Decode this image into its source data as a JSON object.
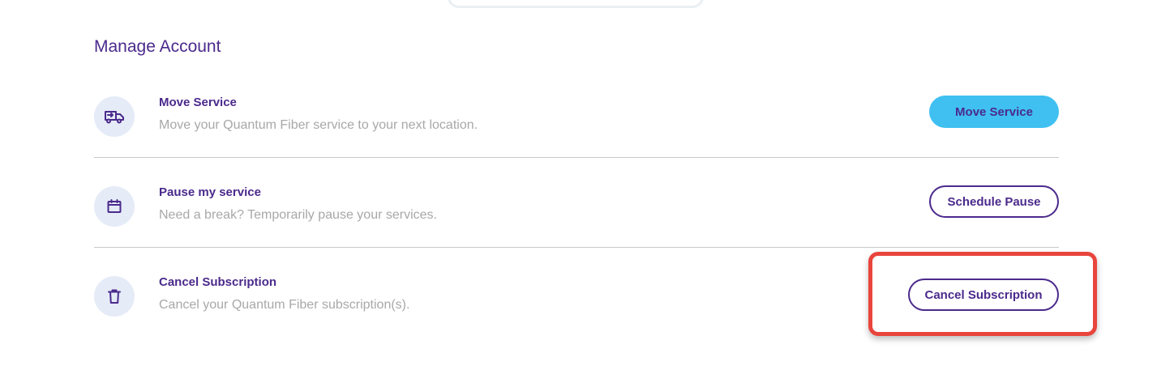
{
  "manage_account": {
    "title": "Manage Account",
    "rows": [
      {
        "icon": "truck-icon",
        "title": "Move Service",
        "description": "Move your Quantum Fiber service to your next location.",
        "button_label": "Move Service",
        "button_style": "filled"
      },
      {
        "icon": "calendar-icon",
        "title": "Pause my service",
        "description": "Need a break? Temporarily pause your services.",
        "button_label": "Schedule Pause",
        "button_style": "outline"
      },
      {
        "icon": "trash-icon",
        "title": "Cancel Subscription",
        "description": "Cancel your Quantum Fiber subscription(s).",
        "button_label": "Cancel Subscription",
        "button_style": "outline"
      }
    ]
  },
  "colors": {
    "primary_text": "#4b2a8c",
    "muted_text": "#a8a8a8",
    "accent_button": "#3fc0f1",
    "icon_bg": "#e5ebf7",
    "highlight": "#e8453c"
  }
}
